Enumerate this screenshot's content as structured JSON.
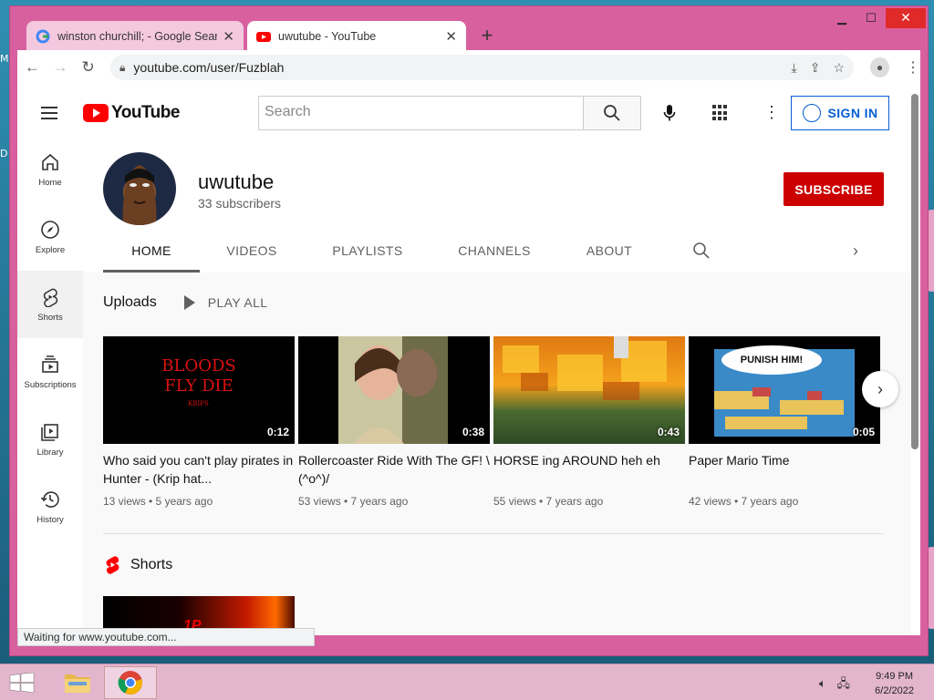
{
  "browser": {
    "tabs": [
      {
        "title": "winston churchill; - Google Search",
        "active": false
      },
      {
        "title": "uwutube - YouTube",
        "active": true
      }
    ],
    "url": "youtube.com/user/Fuzblah",
    "status": "Waiting for www.youtube.com..."
  },
  "yt": {
    "logo": "YouTube",
    "search_placeholder": "Search",
    "signin": "SIGN IN",
    "sidebar": [
      {
        "label": "Home",
        "icon": "home-icon"
      },
      {
        "label": "Explore",
        "icon": "compass-icon"
      },
      {
        "label": "Shorts",
        "icon": "shorts-icon"
      },
      {
        "label": "Subscriptions",
        "icon": "subscriptions-icon"
      },
      {
        "label": "Library",
        "icon": "library-icon"
      },
      {
        "label": "History",
        "icon": "history-icon"
      }
    ],
    "channel": {
      "name": "uwutube",
      "subscribers": "33 subscribers",
      "subscribe": "SUBSCRIBE",
      "tabs": [
        "HOME",
        "VIDEOS",
        "PLAYLISTS",
        "CHANNELS",
        "ABOUT"
      ],
      "active_tab": "HOME"
    },
    "uploads": {
      "title": "Uploads",
      "play_all": "PLAY ALL",
      "videos": [
        {
          "title": "Who said you can't play pirates in Hunter - (Krip hat...",
          "meta": "13 views • 5 years ago",
          "duration": "0:12",
          "thumb_text": "BLOODS FLY DIE",
          "thumb_subtext": "KRIPS"
        },
        {
          "title": "Rollercoaster Ride With The GF! \\(^o^)/",
          "meta": "53 views • 7 years ago",
          "duration": "0:38"
        },
        {
          "title": "HORSE ing AROUND heh eh",
          "meta": "55 views • 7 years ago",
          "duration": "0:43"
        },
        {
          "title": "Paper Mario Time",
          "meta": "42 views • 7 years ago",
          "duration": "0:05",
          "thumb_text": "PUNISH HIM!"
        }
      ]
    },
    "shorts": {
      "title": "Shorts",
      "thumb_text": "1P"
    }
  },
  "taskbar": {
    "time": "9:49 PM",
    "date": "6/2/2022"
  },
  "colors": {
    "yt_red": "#ff0000",
    "subscribe_red": "#cc0000",
    "signin_blue": "#065fd4",
    "window_frame": "#d8609f"
  }
}
